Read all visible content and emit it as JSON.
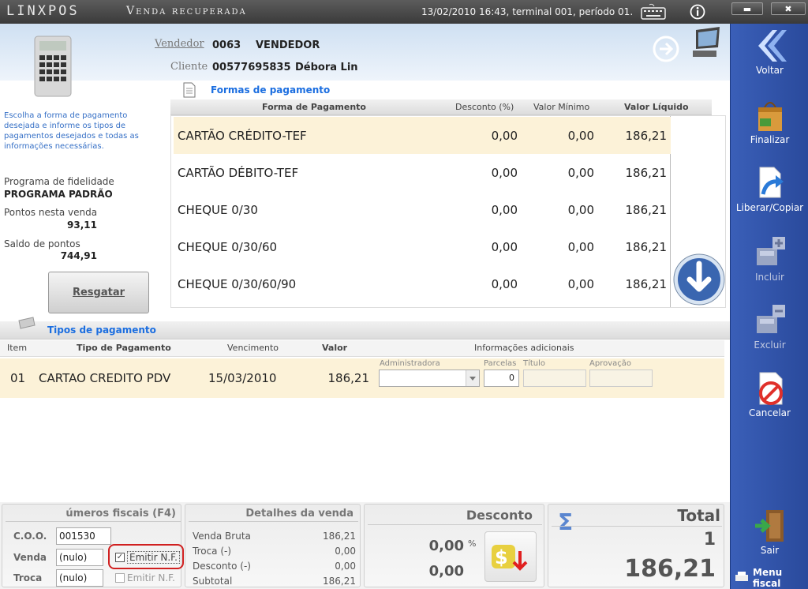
{
  "app": {
    "logo": "LINXPOS",
    "title": "Venda recuperada",
    "datetime": "13/02/2010 16:43, terminal 001, período 01."
  },
  "window": {
    "minimize": "▬",
    "close": "✖"
  },
  "sidebar": {
    "items": [
      {
        "label": "Voltar"
      },
      {
        "label": "Finalizar"
      },
      {
        "label": "Liberar/Copiar"
      },
      {
        "label": "Incluir"
      },
      {
        "label": "Excluir"
      },
      {
        "label": "Cancelar"
      },
      {
        "label": "Sair"
      }
    ],
    "menu_fiscal": "Menu fiscal"
  },
  "header": {
    "vendedor_label": "Vendedor",
    "vendedor_code": "0063",
    "vendedor_name": "VENDEDOR",
    "cliente_label": "Cliente",
    "cliente_code": "00577695835",
    "cliente_name": "Débora Lin"
  },
  "left": {
    "instructions": "Escolha a forma de pagamento desejada e informe os tipos de pagamentos desejados e todas as informações necessárias.",
    "fidelidade_label": "Programa de fidelidade",
    "fidelidade_value": "PROGRAMA PADRÃO",
    "pontos_label": "Pontos nesta venda",
    "pontos_value": "93,11",
    "saldo_label": "Saldo de pontos",
    "saldo_value": "744,91",
    "resgatar": "Resgatar"
  },
  "formas": {
    "title": "Formas de pagamento",
    "cols": [
      "Forma de Pagamento",
      "Desconto (%)",
      "Valor Mínimo",
      "Valor Líquido"
    ],
    "rows": [
      {
        "forma": "CARTÃO CRÉDITO-TEF",
        "desconto": "0,00",
        "minimo": "0,00",
        "liquido": "186,21"
      },
      {
        "forma": "CARTÃO DÉBITO-TEF",
        "desconto": "0,00",
        "minimo": "0,00",
        "liquido": "186,21"
      },
      {
        "forma": "CHEQUE 0/30",
        "desconto": "0,00",
        "minimo": "0,00",
        "liquido": "186,21"
      },
      {
        "forma": "CHEQUE 0/30/60",
        "desconto": "0,00",
        "minimo": "0,00",
        "liquido": "186,21"
      },
      {
        "forma": "CHEQUE 0/30/60/90",
        "desconto": "0,00",
        "minimo": "0,00",
        "liquido": "186,21"
      }
    ]
  },
  "tipos": {
    "title": "Tipos de pagamento",
    "cols": [
      "Item",
      "Tipo de Pagamento",
      "Vencimento",
      "Valor",
      "Informações adicionais"
    ],
    "row": {
      "item": "01",
      "tipo": "CARTAO CREDITO PDV",
      "vencimento": "15/03/2010",
      "valor": "186,21"
    },
    "adicionais": {
      "administradora_label": "Administradora",
      "parcelas_label": "Parcelas",
      "parcelas_value": "0",
      "titulo_label": "Título",
      "aprovacao_label": "Aprovação"
    }
  },
  "fiscais": {
    "title": "úmeros fiscais (F4)",
    "coo_label": "C.O.O.",
    "coo_value": "001530",
    "venda_label": "Venda",
    "venda_value": "(nulo)",
    "troca_label": "Troca",
    "troca_value": "(nulo)",
    "emitir1": "Emitir N.F.",
    "emitir2": "Emitir N.F."
  },
  "detalhes": {
    "title": "Detalhes da venda",
    "rows": [
      {
        "label": "Venda Bruta",
        "value": "186,21"
      },
      {
        "label": "Troca (-)",
        "value": "0,00"
      },
      {
        "label": "Desconto (-)",
        "value": "0,00"
      },
      {
        "label": "Subtotal",
        "value": "186,21"
      }
    ]
  },
  "desconto": {
    "title": "Desconto",
    "percent": "0,00",
    "percent_sign": "%",
    "value": "0,00"
  },
  "total": {
    "title": "Total",
    "count": "1",
    "value": "186,21",
    "sigma": "Σ"
  }
}
